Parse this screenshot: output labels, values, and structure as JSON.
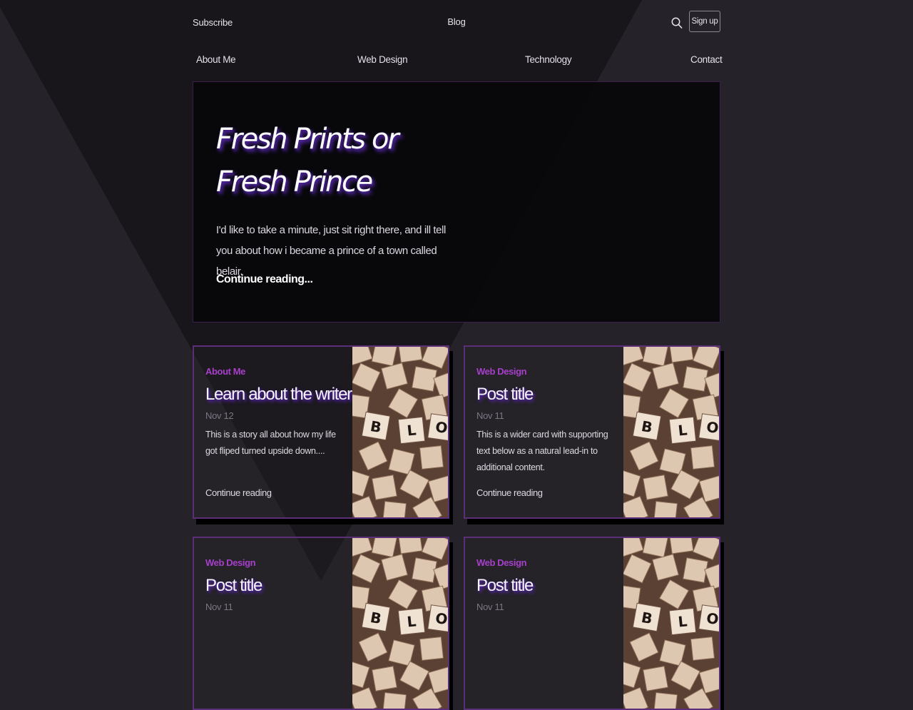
{
  "header": {
    "subscribe": "Subscribe",
    "blog_title": "Blog",
    "search_icon": "search-icon",
    "signup": "Sign up"
  },
  "nav": [
    "About Me",
    "Web Design",
    "Technology",
    "Contact"
  ],
  "hero": {
    "title": "Fresh Prints or Fresh Prince",
    "text": "I'd like to take a minute, just sit right there, and ill tell you about how i became a prince of a town called belair.",
    "link": "Continue reading..."
  },
  "cards": [
    {
      "category": "About Me",
      "title": "Learn about the writer",
      "date": "Nov 12",
      "excerpt": "This is a story all about how my life got fliped turned upside down....",
      "link": "Continue reading"
    },
    {
      "category": "Web Design",
      "title": "Post title",
      "date": "Nov 11",
      "excerpt": "This is a wider card with supporting text below as a natural lead-in to additional content.",
      "link": "Continue reading"
    },
    {
      "category": "Web Design",
      "title": "Post title",
      "date": "Nov 11",
      "excerpt": "",
      "link": ""
    },
    {
      "category": "Web Design",
      "title": "Post title",
      "date": "Nov 11",
      "excerpt": "",
      "link": ""
    }
  ],
  "thumbnail": {
    "tile_letters": [
      "B",
      "L",
      "O"
    ]
  },
  "colors": {
    "background": "#262229",
    "accent": "#a540c9",
    "card_border": "#5a2f78",
    "title_glow": "#5d2bb3"
  }
}
